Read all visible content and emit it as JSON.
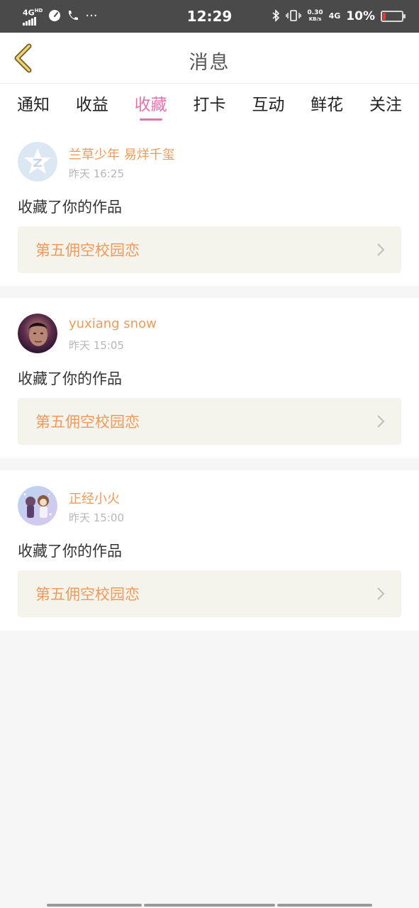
{
  "status_bar": {
    "network": "4G",
    "network_sup": "HD",
    "time": "12:29",
    "speed_value": "0.30",
    "speed_unit": "KB/s",
    "network2": "4G",
    "battery": "10%"
  },
  "header": {
    "title": "消息",
    "back_icon": "chevron-left-icon"
  },
  "tabs": [
    {
      "label": "通知",
      "active": false
    },
    {
      "label": "收益",
      "active": false
    },
    {
      "label": "收藏",
      "active": true
    },
    {
      "label": "打卡",
      "active": false
    },
    {
      "label": "互动",
      "active": false
    },
    {
      "label": "鲜花",
      "active": false
    },
    {
      "label": "关注",
      "active": false
    }
  ],
  "messages": [
    {
      "user": "兰草少年 易烊千玺",
      "time": "昨天 16:25",
      "action": "收藏了你的作品",
      "work": "第五佣空校园恋",
      "avatar": "default-star-avatar"
    },
    {
      "user": "yuxiang snow",
      "time": "昨天 15:05",
      "action": "收藏了你的作品",
      "work": "第五佣空校园恋",
      "avatar": "photo-avatar"
    },
    {
      "user": "正经小火",
      "time": "昨天 15:00",
      "action": "收藏了你的作品",
      "work": "第五佣空校园恋",
      "avatar": "anime-avatar"
    }
  ],
  "colors": {
    "accent": "#e074b0",
    "name": "#ef9a5a",
    "link_bg": "#f4f3ec"
  }
}
